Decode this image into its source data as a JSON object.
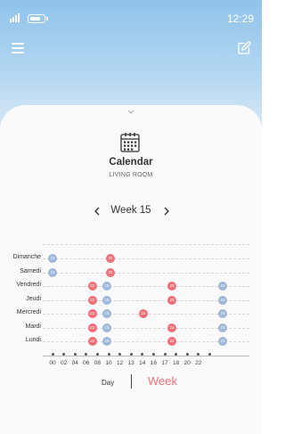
{
  "status_bar": {
    "time": "12:29"
  },
  "header": {
    "menu_icon": "hamburger-menu-icon",
    "edit_icon": "edit-pencil-icon"
  },
  "card": {
    "collapse_icon": "chevron-down-icon",
    "calendar_icon": "calendar-icon",
    "title": "Calendar",
    "subtitle": "LIVING ROOM"
  },
  "week_nav": {
    "label": "Week 15",
    "prev_icon": "chevron-left-icon",
    "next_icon": "chevron-right-icon"
  },
  "schedule": {
    "days": [
      {
        "name": "Dimanche",
        "markers": [
          {
            "hour": 0,
            "label": "15",
            "color": "blue"
          },
          {
            "hour": 8,
            "label": "22",
            "color": "red"
          }
        ]
      },
      {
        "name": "Samedi",
        "markers": [
          {
            "hour": 0,
            "label": "15",
            "color": "blue"
          },
          {
            "hour": 8,
            "label": "22",
            "color": "red"
          }
        ]
      },
      {
        "name": "Vendredi",
        "markers": [
          {
            "hour": 5.5,
            "label": "22",
            "color": "red"
          },
          {
            "hour": 7.5,
            "label": "15",
            "color": "blue"
          },
          {
            "hour": 16.5,
            "label": "22",
            "color": "red"
          },
          {
            "hour": 23.5,
            "label": "15",
            "color": "blue"
          }
        ]
      },
      {
        "name": "Jeudi",
        "markers": [
          {
            "hour": 5.5,
            "label": "22",
            "color": "red"
          },
          {
            "hour": 7.5,
            "label": "15",
            "color": "blue"
          },
          {
            "hour": 16.5,
            "label": "22",
            "color": "red"
          },
          {
            "hour": 23.5,
            "label": "15",
            "color": "blue"
          }
        ]
      },
      {
        "name": "Mercredi",
        "markers": [
          {
            "hour": 5.5,
            "label": "22",
            "color": "red"
          },
          {
            "hour": 7.5,
            "label": "15",
            "color": "blue"
          },
          {
            "hour": 12.5,
            "label": "22",
            "color": "red"
          },
          {
            "hour": 23.5,
            "label": "15",
            "color": "blue"
          }
        ]
      },
      {
        "name": "Mardi",
        "markers": [
          {
            "hour": 5.5,
            "label": "22",
            "color": "red"
          },
          {
            "hour": 7.5,
            "label": "15",
            "color": "blue"
          },
          {
            "hour": 16.5,
            "label": "22",
            "color": "red"
          },
          {
            "hour": 23.5,
            "label": "15",
            "color": "blue"
          }
        ]
      },
      {
        "name": "Lundi",
        "markers": [
          {
            "hour": 5.5,
            "label": "22",
            "color": "red"
          },
          {
            "hour": 7.5,
            "label": "15",
            "color": "blue"
          },
          {
            "hour": 16.5,
            "label": "22",
            "color": "red"
          },
          {
            "hour": 23.5,
            "label": "15",
            "color": "blue"
          }
        ]
      }
    ],
    "hour_ticks": [
      "00",
      "02",
      "04",
      "06",
      "08",
      "10",
      "12",
      "13",
      "14",
      "16",
      "17",
      "18",
      "20",
      "22"
    ]
  },
  "view_tabs": {
    "day_label": "Day",
    "week_label": "Week",
    "active": "Week"
  },
  "colors": {
    "red_marker": "#ef6f78",
    "blue_marker": "#9fb7d8",
    "header_gradient_top": "#8fc3ea"
  }
}
